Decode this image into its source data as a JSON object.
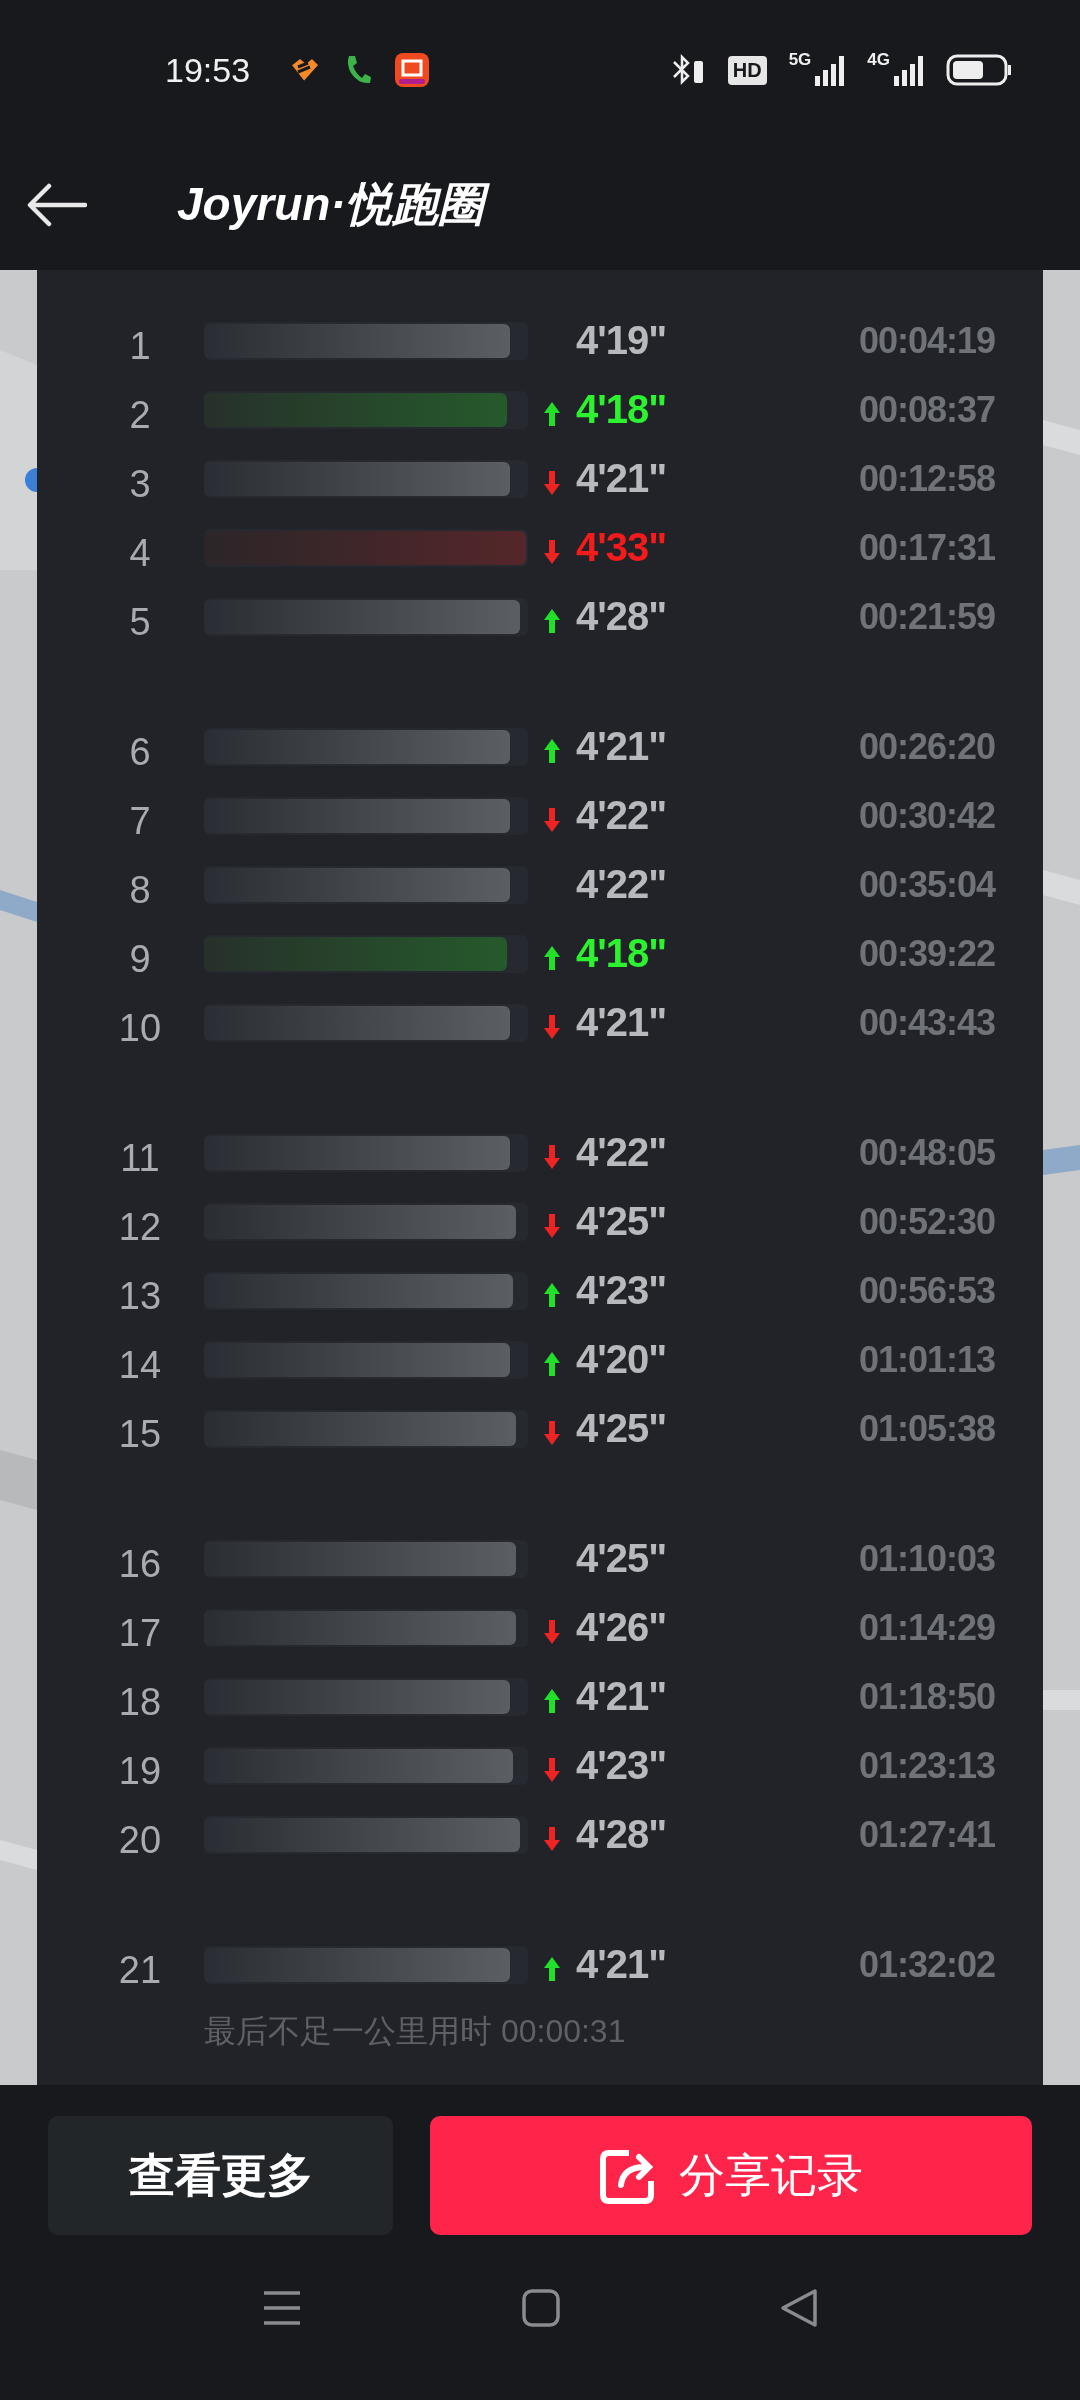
{
  "status_bar": {
    "time": "19:53",
    "hd": "HD",
    "net_1": "5G",
    "net_2": "4G"
  },
  "header": {
    "title": "Joyrun·悦跑圈"
  },
  "splits": {
    "groups": [
      {
        "rows": [
          {
            "km": "1",
            "level": 0.95,
            "fastest": false,
            "slowest": false,
            "faster": false,
            "slower": false,
            "pace": "4'19\"",
            "time": "00:04:19"
          },
          {
            "km": "2",
            "level": 0.94,
            "fastest": true,
            "slowest": false,
            "faster": true,
            "slower": false,
            "pace": "4'18\"",
            "time": "00:08:37"
          },
          {
            "km": "3",
            "level": 0.95,
            "fastest": false,
            "slowest": false,
            "faster": false,
            "slower": true,
            "pace": "4'21\"",
            "time": "00:12:58"
          },
          {
            "km": "4",
            "level": 1.0,
            "fastest": false,
            "slowest": true,
            "faster": false,
            "slower": true,
            "pace": "4'33\"",
            "time": "00:17:31"
          },
          {
            "km": "5",
            "level": 0.98,
            "fastest": false,
            "slowest": false,
            "faster": true,
            "slower": false,
            "pace": "4'28\"",
            "time": "00:21:59"
          }
        ]
      },
      {
        "rows": [
          {
            "km": "6",
            "level": 0.95,
            "fastest": false,
            "slowest": false,
            "faster": true,
            "slower": false,
            "pace": "4'21\"",
            "time": "00:26:20"
          },
          {
            "km": "7",
            "level": 0.95,
            "fastest": false,
            "slowest": false,
            "faster": false,
            "slower": true,
            "pace": "4'22\"",
            "time": "00:30:42"
          },
          {
            "km": "8",
            "level": 0.95,
            "fastest": false,
            "slowest": false,
            "faster": false,
            "slower": false,
            "pace": "4'22\"",
            "time": "00:35:04"
          },
          {
            "km": "9",
            "level": 0.94,
            "fastest": true,
            "slowest": false,
            "faster": true,
            "slower": false,
            "pace": "4'18\"",
            "time": "00:39:22"
          },
          {
            "km": "10",
            "level": 0.95,
            "fastest": false,
            "slowest": false,
            "faster": false,
            "slower": true,
            "pace": "4'21\"",
            "time": "00:43:43"
          }
        ]
      },
      {
        "rows": [
          {
            "km": "11",
            "level": 0.95,
            "fastest": false,
            "slowest": false,
            "faster": false,
            "slower": true,
            "pace": "4'22\"",
            "time": "00:48:05"
          },
          {
            "km": "12",
            "level": 0.97,
            "fastest": false,
            "slowest": false,
            "faster": false,
            "slower": true,
            "pace": "4'25\"",
            "time": "00:52:30"
          },
          {
            "km": "13",
            "level": 0.96,
            "fastest": false,
            "slowest": false,
            "faster": true,
            "slower": false,
            "pace": "4'23\"",
            "time": "00:56:53"
          },
          {
            "km": "14",
            "level": 0.95,
            "fastest": false,
            "slowest": false,
            "faster": true,
            "slower": false,
            "pace": "4'20\"",
            "time": "01:01:13"
          },
          {
            "km": "15",
            "level": 0.97,
            "fastest": false,
            "slowest": false,
            "faster": false,
            "slower": true,
            "pace": "4'25\"",
            "time": "01:05:38"
          }
        ]
      },
      {
        "rows": [
          {
            "km": "16",
            "level": 0.97,
            "fastest": false,
            "slowest": false,
            "faster": false,
            "slower": false,
            "pace": "4'25\"",
            "time": "01:10:03"
          },
          {
            "km": "17",
            "level": 0.97,
            "fastest": false,
            "slowest": false,
            "faster": false,
            "slower": true,
            "pace": "4'26\"",
            "time": "01:14:29"
          },
          {
            "km": "18",
            "level": 0.95,
            "fastest": false,
            "slowest": false,
            "faster": true,
            "slower": false,
            "pace": "4'21\"",
            "time": "01:18:50"
          },
          {
            "km": "19",
            "level": 0.96,
            "fastest": false,
            "slowest": false,
            "faster": false,
            "slower": true,
            "pace": "4'23\"",
            "time": "01:23:13"
          },
          {
            "km": "20",
            "level": 0.98,
            "fastest": false,
            "slowest": false,
            "faster": false,
            "slower": true,
            "pace": "4'28\"",
            "time": "01:27:41"
          }
        ]
      },
      {
        "rows": [
          {
            "km": "21",
            "level": 0.95,
            "fastest": false,
            "slowest": false,
            "faster": true,
            "slower": false,
            "pace": "4'21\"",
            "time": "01:32:02"
          }
        ]
      }
    ],
    "footnote": "最后不足一公里用时 00:00:31"
  },
  "buttons": {
    "more": "查看更多",
    "share": "分享记录"
  }
}
